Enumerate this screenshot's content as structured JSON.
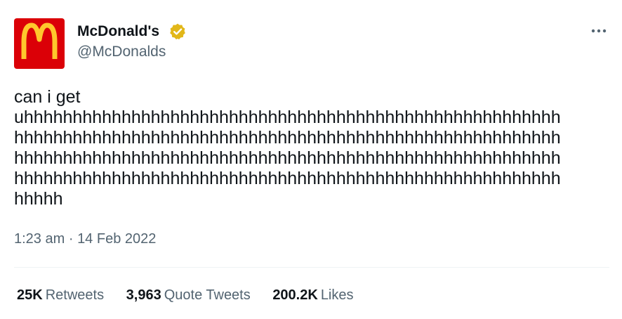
{
  "account": {
    "display_name": "McDonald's",
    "handle": "@McDonalds",
    "avatar_icon": "mcdonalds-golden-arches-logo",
    "verified_icon": "gold-verified-badge-icon",
    "brand_red": "#db0007",
    "brand_gold": "#ffc72c",
    "verified_gold": "#e2b719"
  },
  "menu": {
    "icon": "more-options-icon"
  },
  "tweet": {
    "text": "can i get\nuhhhhhhhhhhhhhhhhhhhhhhhhhhhhhhhhhhhhhhhhhhhhhhhhhhhhhhh\nhhhhhhhhhhhhhhhhhhhhhhhhhhhhhhhhhhhhhhhhhhhhhhhhhhhhhhhh\nhhhhhhhhhhhhhhhhhhhhhhhhhhhhhhhhhhhhhhhhhhhhhhhhhhhhhhhh\nhhhhhhhhhhhhhhhhhhhhhhhhhhhhhhhhhhhhhhhhhhhhhhhhhhhhhhhh\nhhhhh",
    "time": "1:23 am",
    "separator": "·",
    "date": "14 Feb 2022"
  },
  "stats": {
    "retweets_count": "25K",
    "retweets_label": "Retweets",
    "quotes_count": "3,963",
    "quotes_label": "Quote Tweets",
    "likes_count": "200.2K",
    "likes_label": "Likes"
  }
}
